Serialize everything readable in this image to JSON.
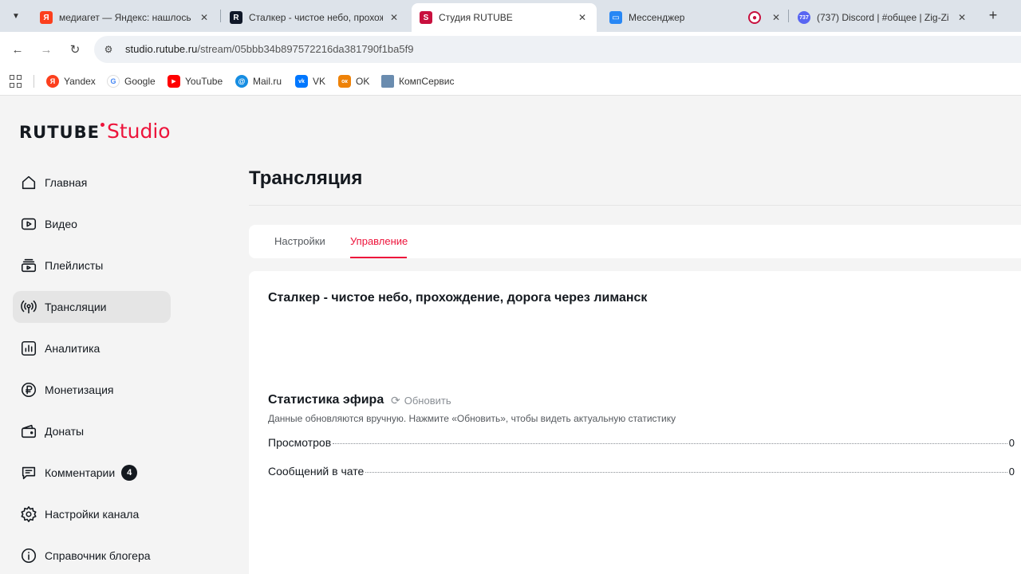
{
  "browser": {
    "tabs": [
      {
        "title": "медиагет — Яндекс: нашлось",
        "favicon": "Я",
        "favicon_color": "#fc3f1d",
        "active": false
      },
      {
        "title": "Сталкер - чистое небо, прохож",
        "favicon": "R",
        "favicon_color": "#101828",
        "active": false
      },
      {
        "title": "Студия RUTUBE",
        "favicon": "S",
        "favicon_color": "#c8103e",
        "active": true
      },
      {
        "title": "Мессенджер",
        "favicon": "chat-icon",
        "favicon_color": "#2787f5",
        "active": false
      },
      {
        "title": "",
        "favicon": "record-icon",
        "favicon_color": "#c8103e",
        "active": false
      },
      {
        "title": "(737) Discord | #общее | Zig-Zi",
        "favicon": "737",
        "favicon_color": "#5865f2",
        "active": false
      }
    ],
    "url_host": "studio.rutube.ru",
    "url_path": "/stream/05bbb34b897572216da381790f1ba5f9",
    "bookmarks": [
      {
        "label": "Yandex",
        "icon": "Я",
        "color": "#fc3f1d"
      },
      {
        "label": "Google",
        "icon": "G",
        "color": "#4285f4"
      },
      {
        "label": "YouTube",
        "icon": "▶",
        "color": "#ff0000"
      },
      {
        "label": "Mail.ru",
        "icon": "@",
        "color": "#168de2"
      },
      {
        "label": "VK",
        "icon": "vk",
        "color": "#0077ff"
      },
      {
        "label": "OK",
        "icon": "ок",
        "color": "#ee8208"
      },
      {
        "label": "КомпСервис",
        "icon": "monitor-icon",
        "color": "#6a8caf"
      }
    ]
  },
  "logo": {
    "main": "RUTUBE",
    "sub": "Studio",
    "accent": "#ed143b"
  },
  "sidebar": {
    "items": [
      {
        "label": "Главная",
        "icon": "home-icon"
      },
      {
        "label": "Видео",
        "icon": "video-icon"
      },
      {
        "label": "Плейлисты",
        "icon": "playlist-icon"
      },
      {
        "label": "Трансляции",
        "icon": "broadcast-icon",
        "active": true
      },
      {
        "label": "Аналитика",
        "icon": "analytics-icon"
      },
      {
        "label": "Монетизация",
        "icon": "ruble-icon"
      },
      {
        "label": "Донаты",
        "icon": "wallet-icon"
      },
      {
        "label": "Комментарии",
        "icon": "comment-icon",
        "badge": "4"
      },
      {
        "label": "Настройки канала",
        "icon": "gear-icon"
      },
      {
        "label": "Справочник блогера",
        "icon": "info-icon"
      }
    ]
  },
  "main": {
    "title": "Трансляция",
    "tabs": [
      {
        "label": "Настройки",
        "active": false
      },
      {
        "label": "Управление",
        "active": true
      }
    ],
    "stream_title": "Сталкер - чистое небо, прохождение, дорога через лиманск",
    "stats": {
      "title": "Статистика эфира",
      "refresh_label": "Обновить",
      "note": "Данные обновляются вручную. Нажмите «Обновить», чтобы видеть актуальную статистику",
      "rows": [
        {
          "label": "Просмотров",
          "value": "0"
        },
        {
          "label": "Сообщений в чате",
          "value": "0"
        }
      ]
    }
  }
}
